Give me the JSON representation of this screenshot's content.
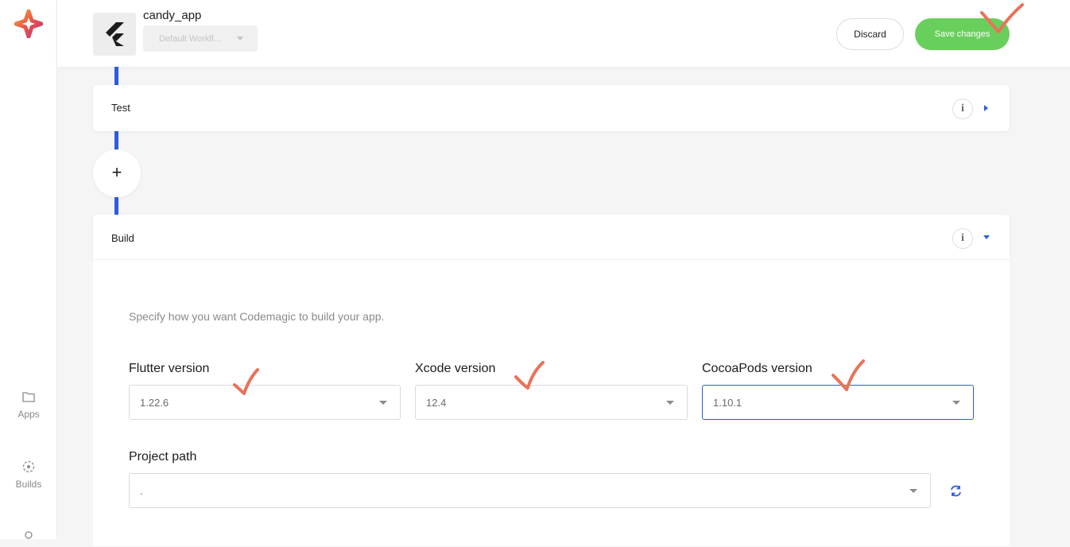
{
  "sidebar": {
    "items": [
      {
        "label": "Apps",
        "icon": "folder-icon"
      },
      {
        "label": "Builds",
        "icon": "builds-icon"
      },
      {
        "label": "",
        "icon": "settings-icon"
      }
    ]
  },
  "header": {
    "app_name": "candy_app",
    "workflow_select": "Default Workfl...",
    "discard_label": "Discard",
    "save_label": "Save changes"
  },
  "sections": {
    "test": {
      "title": "Test",
      "info": "i"
    },
    "add": "+",
    "build": {
      "title": "Build",
      "info": "i",
      "description": "Specify how you want Codemagic to build your app.",
      "flutter": {
        "label": "Flutter version",
        "value": "1.22.6"
      },
      "xcode": {
        "label": "Xcode version",
        "value": "12.4"
      },
      "cocoapods": {
        "label": "CocoaPods version",
        "value": "1.10.1"
      },
      "project_path": {
        "label": "Project path",
        "value": "."
      }
    }
  },
  "colors": {
    "accent": "#2d5be3",
    "save_green": "#69cf5c",
    "annotation": "#e8725a"
  }
}
